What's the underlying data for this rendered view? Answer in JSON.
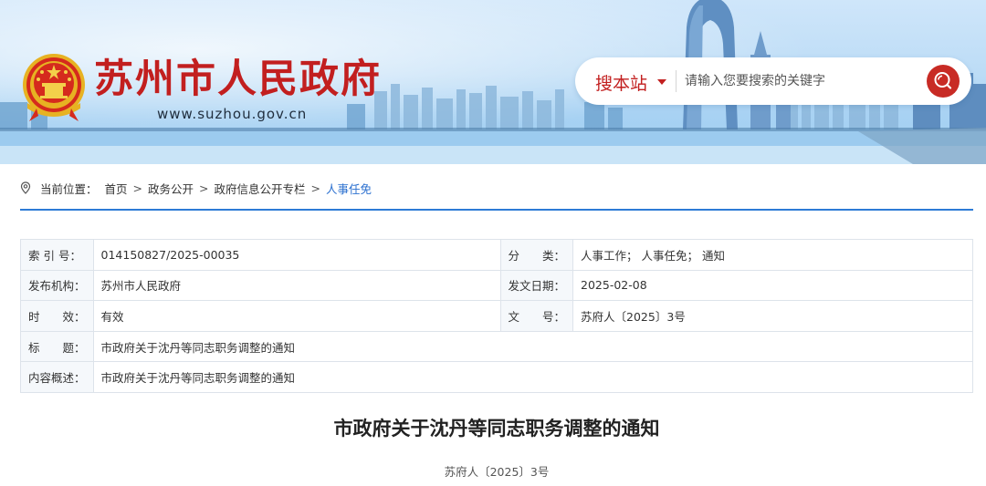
{
  "header": {
    "site_title": "苏州市人民政府",
    "site_url": "www.suzhou.gov.cn",
    "emblem": "national-emblem"
  },
  "search": {
    "scope_label": "搜本站",
    "placeholder": "请输入您要搜索的关键字",
    "button_icon": "search-icon"
  },
  "breadcrumb": {
    "prefix": "当前位置：",
    "items": [
      "首页",
      "政务公开",
      "政府信息公开专栏",
      "人事任免"
    ],
    "separator": ">"
  },
  "meta": {
    "index_label": "索 引 号：",
    "index_value": "014150827/2025-00035",
    "category_label": "分　　类：",
    "category_value": "人事工作； 人事任免； 通知",
    "publisher_label": "发布机构：",
    "publisher_value": "苏州市人民政府",
    "date_label": "发文日期：",
    "date_value": "2025-02-08",
    "validity_label": "时　　效：",
    "validity_value": "有效",
    "doc_no_label": "文　　号：",
    "doc_no_value": "苏府人〔2025〕3号",
    "title_label": "标　　题：",
    "title_value": "市政府关于沈丹等同志职务调整的通知",
    "summary_label": "内容概述：",
    "summary_value": "市政府关于沈丹等同志职务调整的通知"
  },
  "article": {
    "title": "市政府关于沈丹等同志职务调整的通知",
    "doc_number": "苏府人〔2025〕3号"
  },
  "colors": {
    "brand_red": "#c21f1f",
    "link_blue": "#2a6fcf",
    "rule_blue": "#2d7bd6"
  }
}
